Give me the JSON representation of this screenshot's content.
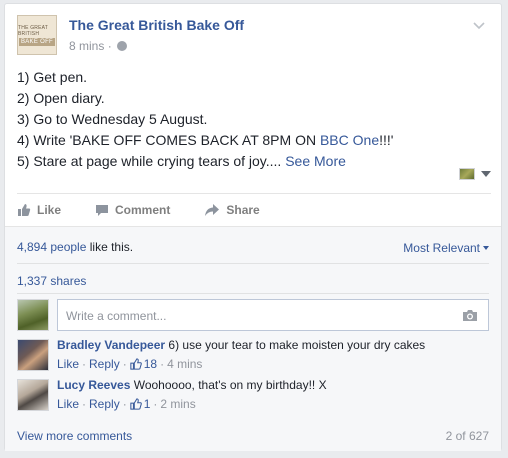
{
  "post": {
    "page_logo_line1": "THE GREAT BRITISH",
    "page_logo_line2": "BAKE OFF",
    "page_name": "The Great British Bake Off",
    "time": "8 mins",
    "dot": "·",
    "lines": [
      "1) Get pen.",
      "2) Open diary.",
      "3) Go to Wednesday 5 August."
    ],
    "line4_prefix": "4) Write 'BAKE OFF COMES BACK AT 8PM ON ",
    "line4_link": "BBC One",
    "line4_suffix": "!!!'",
    "line5": "5) Stare at page while crying tears of joy....",
    "see_more": "See More"
  },
  "actions": {
    "like": "Like",
    "comment": "Comment",
    "share": "Share"
  },
  "ufi": {
    "likes_count": "4,894 people",
    "likes_suffix": " like this.",
    "most_relevant": "Most Relevant",
    "shares": "1,337 shares",
    "comment_placeholder": "Write a comment..."
  },
  "comments": [
    {
      "author": "Bradley Vandepeer",
      "text": " 6) use your tear to make moisten your dry cakes",
      "like": "Like",
      "reply": "Reply",
      "likes": "18",
      "time": "4 mins"
    },
    {
      "author": "Lucy Reeves",
      "text": " Woohoooo, that's on my birthday!! X",
      "like": "Like",
      "reply": "Reply",
      "likes": "1",
      "time": "2 mins"
    }
  ],
  "footer": {
    "view_more": "View more comments",
    "pager": "2 of 627"
  },
  "colors": {
    "link": "#365899",
    "muted": "#90949c",
    "background": "#e9ebee"
  },
  "icons": [
    "chevron-down-icon",
    "globe-icon",
    "like-thumb-icon",
    "comment-bubble-icon",
    "share-arrow-icon",
    "camera-icon",
    "audience-caret-icon"
  ]
}
